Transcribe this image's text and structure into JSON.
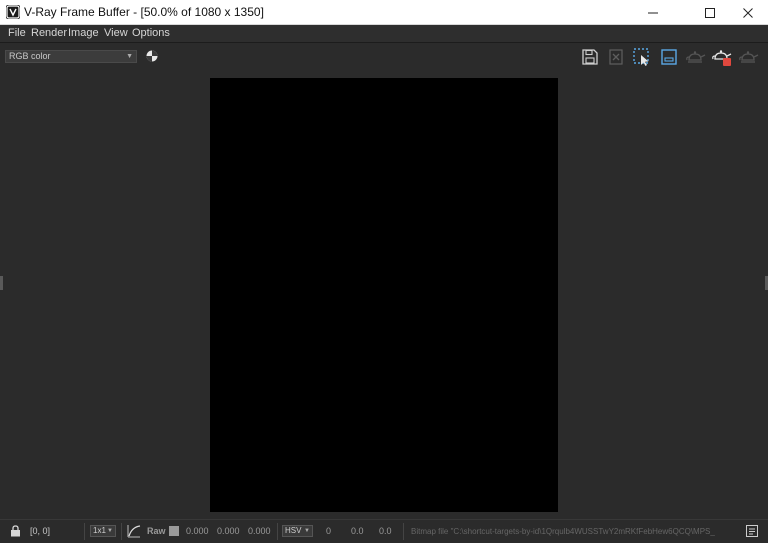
{
  "window": {
    "title": "V-Ray Frame Buffer - [50.0% of 1080 x 1350]",
    "controls": [
      "minimize",
      "maximize",
      "close"
    ]
  },
  "menu": {
    "items": [
      "File",
      "Render",
      "Image",
      "View",
      "Options"
    ]
  },
  "toolbar": {
    "channel": "RGB color",
    "icons": [
      "save-image-icon",
      "clear-image-icon",
      "region-render-icon",
      "frame-icon",
      "render-last-icon",
      "stop-render-icon",
      "render-icon"
    ]
  },
  "canvas": {
    "color": "#000000"
  },
  "statusbar": {
    "coords": "[0, 0]",
    "zoom_mode": "1x1",
    "raw_label": "Raw",
    "raw_values": [
      "0.000",
      "0.000",
      "0.000"
    ],
    "color_mode": "HSV",
    "hsv_values": [
      "0",
      "0.0",
      "0.0"
    ],
    "file_path": "Bitmap file \"C:\\shortcut-targets-by-id\\1Qrqulb4WUSSTwY2mRKfFebHew6QCQ\\MPS_"
  },
  "colors": {
    "background": "#2b2b2b",
    "menu_text": "#d6d6d6",
    "accent_blue": "#5aa9e6",
    "stop_red": "#e0483e"
  }
}
